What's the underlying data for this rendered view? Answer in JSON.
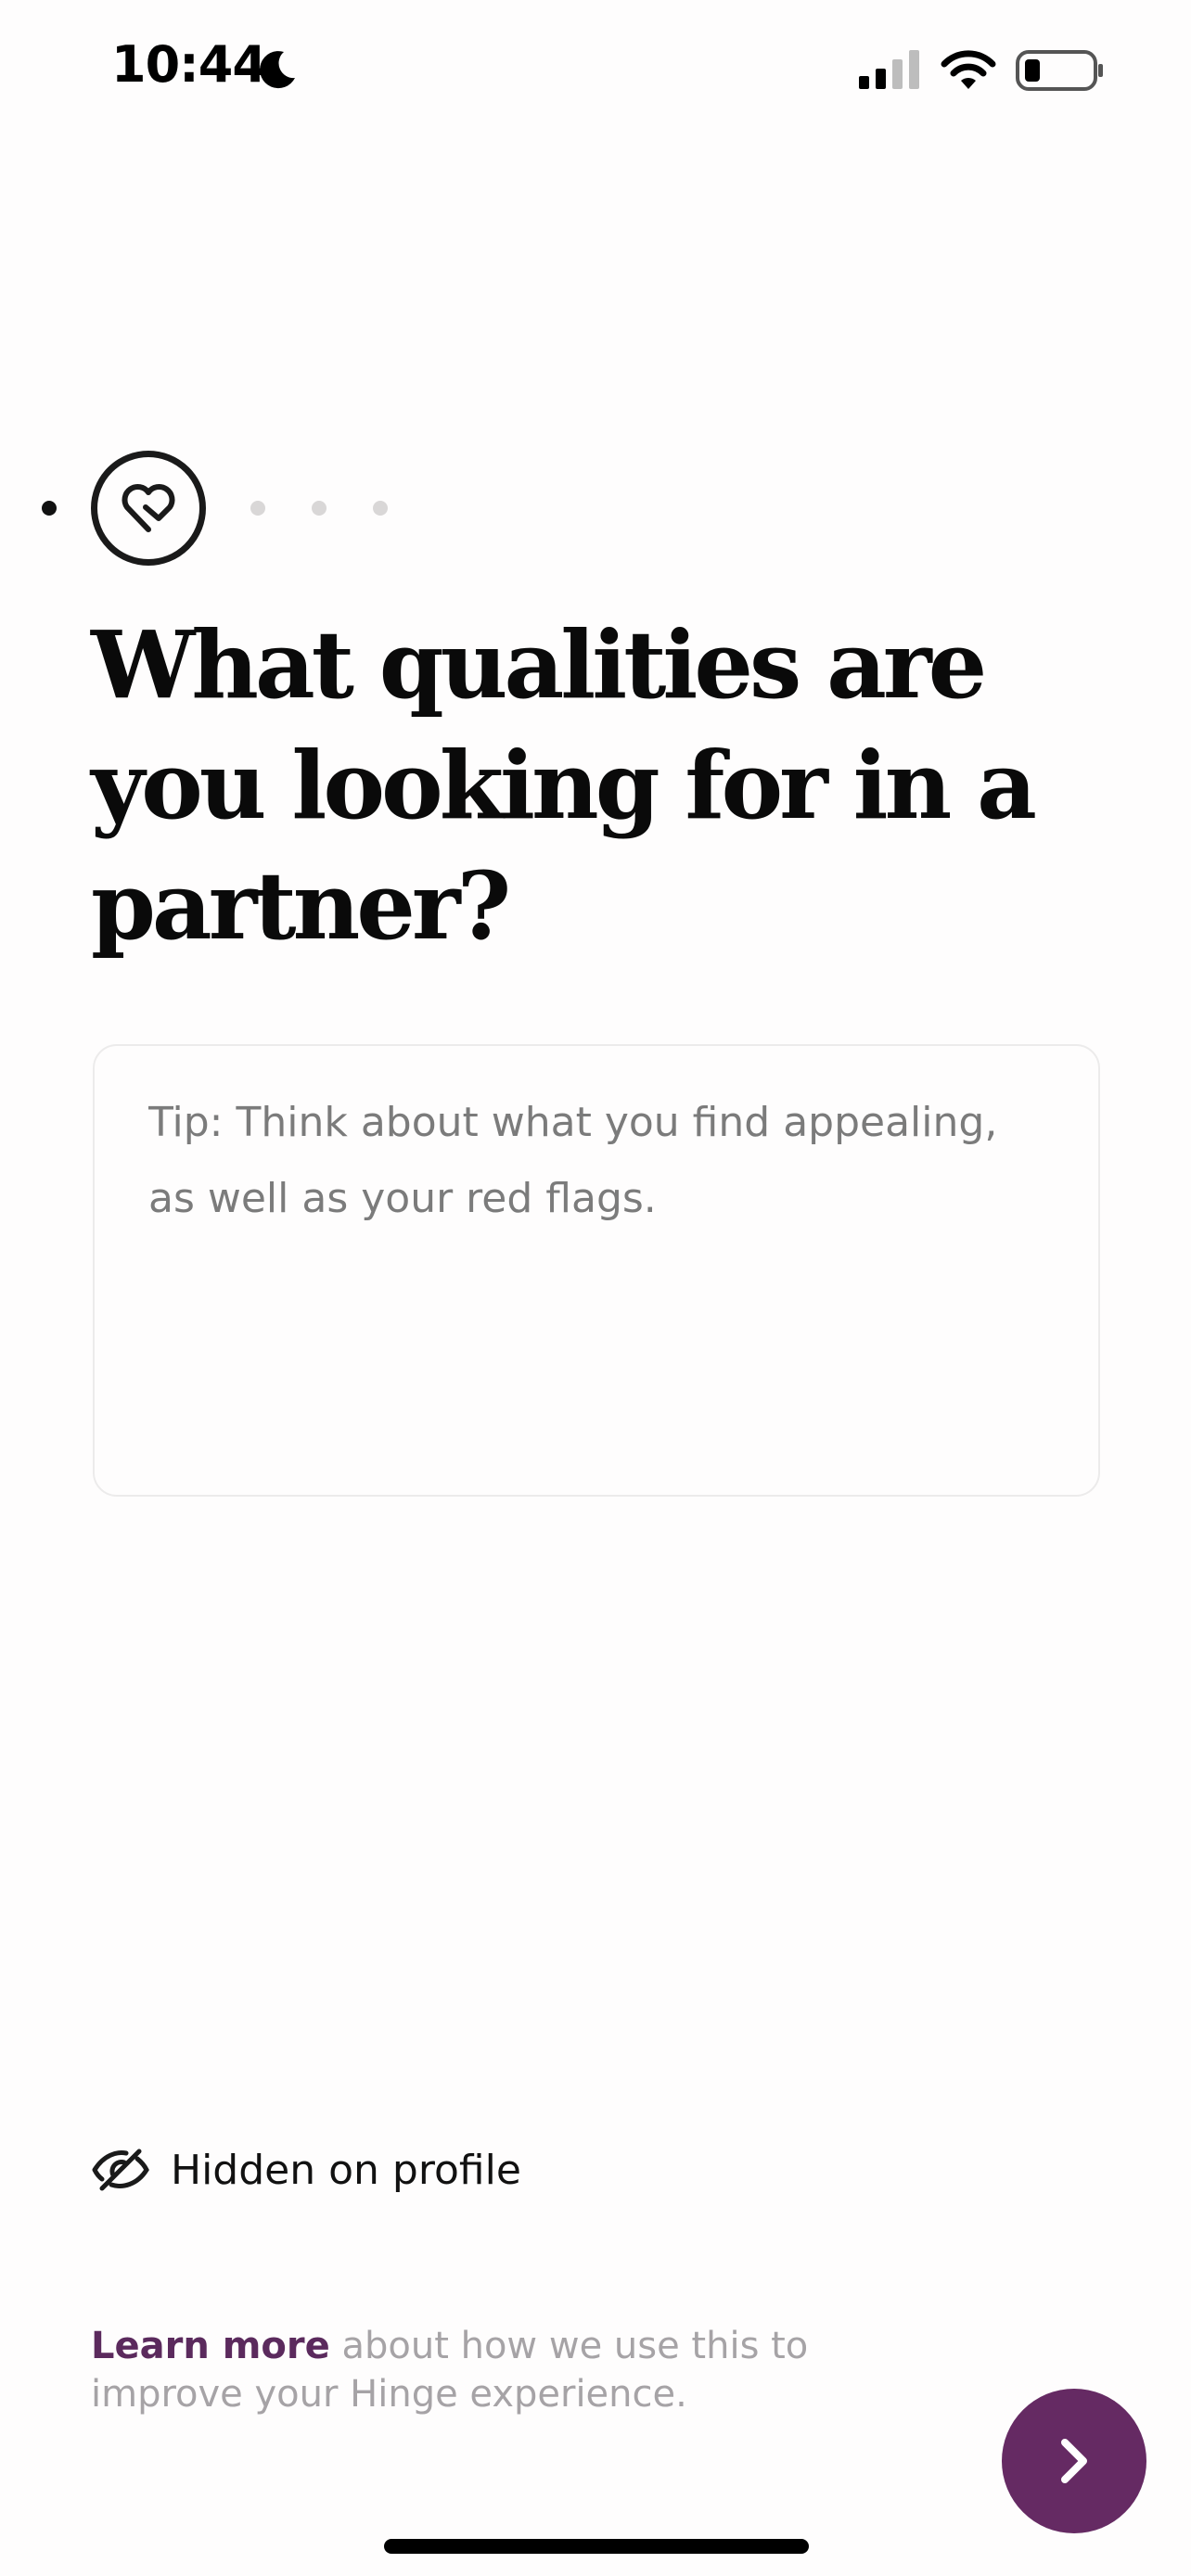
{
  "status_bar": {
    "time": "10:44",
    "icons": [
      "moon-icon",
      "signal-icon",
      "wifi-icon",
      "battery-icon"
    ]
  },
  "progress": {
    "current_step_icon": "heart-icon",
    "completed_steps": 1,
    "remaining_steps": 3
  },
  "question": {
    "title": "What qualities are you looking for in a partner?"
  },
  "answer": {
    "value": "",
    "placeholder": "Tip: Think about what you find appealing, as well as your red flags."
  },
  "visibility": {
    "icon": "eye-off-icon",
    "label": "Hidden on profile"
  },
  "footer": {
    "link_text": "Learn more",
    "rest_text": " about how we use this to improve your Hinge experience."
  },
  "next_button": {
    "icon": "chevron-right-icon"
  },
  "colors": {
    "accent": "#652a63",
    "link": "#5b2a5d",
    "background": "#fefdfd",
    "muted_text": "#a6a3a6"
  }
}
